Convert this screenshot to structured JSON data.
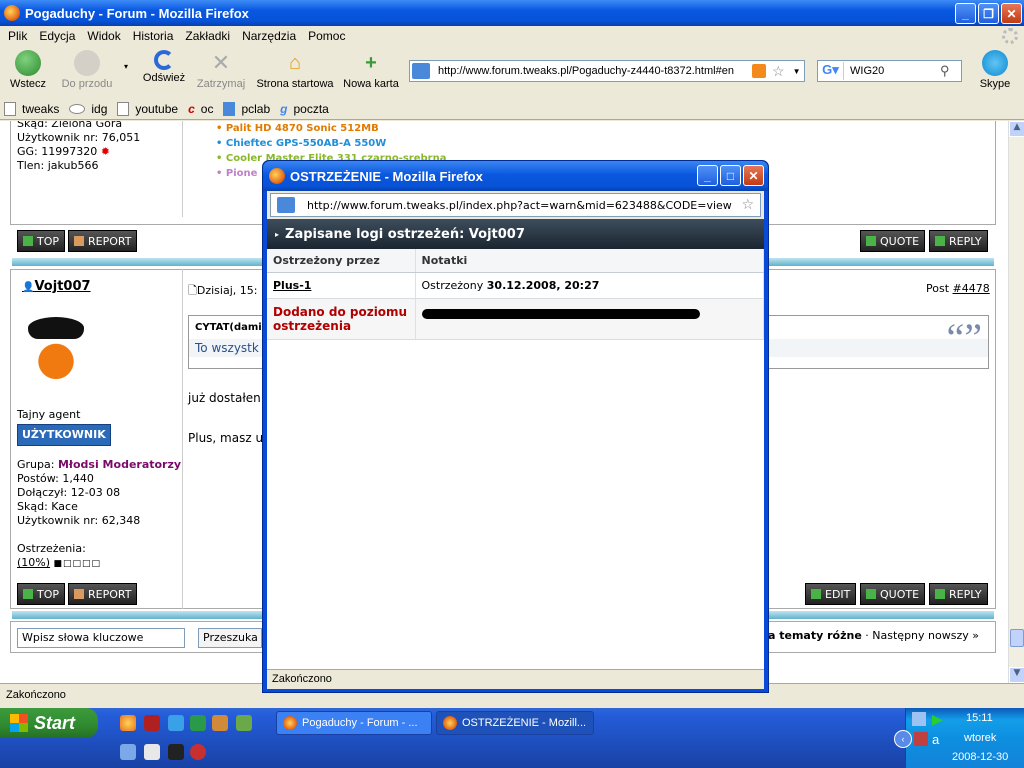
{
  "window": {
    "title": "Pogaduchy - Forum - Mozilla Firefox"
  },
  "menu": [
    "Plik",
    "Edycja",
    "Widok",
    "Historia",
    "Zakładki",
    "Narzędzia",
    "Pomoc"
  ],
  "nav": {
    "back": "Wstecz",
    "forward": "Do przodu",
    "reload": "Odśwież",
    "stop": "Zatrzymaj",
    "home": "Strona startowa",
    "newtab": "Nowa karta",
    "skype": "Skype"
  },
  "url": "http://www.forum.tweaks.pl/Pogaduchy-z4440-t8372.html#en",
  "search": "WIG20",
  "bookmarks": [
    "tweaks",
    "idg",
    "youtube",
    "oc",
    "pclab",
    "poczta"
  ],
  "forum": {
    "user1": {
      "skad": "Skąd: Zielona Góra",
      "nr": "Użytkownik nr: 76,051",
      "gg": "GG: 11997320",
      "tlen": "Tlen: jakub566"
    },
    "specs": [
      "Palit HD 4870 Sonic 512MB",
      "Chieftec GPS-550AB-A 550W",
      "Cooler Master Elite 331 czarno-srebrna",
      "Pione"
    ],
    "top": "TOP",
    "report": "REPORT",
    "quote": "QUOTE",
    "reply": "REPLY",
    "edit": "EDIT",
    "post": {
      "author": "Vojt007",
      "date": "Dzisiaj, 15:",
      "post_label": "Post",
      "post_num": "#4478",
      "quote_head": "CYTAT(dami",
      "quote_text": "To wszystk",
      "line1": "już dostałen",
      "line2": "Plus, masz u"
    },
    "user2": {
      "title": "Tajny agent",
      "badge": "UŻYTKOWNIK",
      "grupa_label": "Grupa:",
      "grupa": "Młodsi Moderatorzy",
      "posty": "Postów: 1,440",
      "dolaczyl": "Dołączył: 12-03 08",
      "skad": "Skąd: Kace",
      "nr": "Użytkownik nr: 62,348",
      "ostrz": "Ostrzeżenia:",
      "ostrz_val": "(10%)"
    },
    "search_placeholder": "Wpisz słowa kluczowe",
    "search_btn": "Przeszuka",
    "bottom_nav_bold": "a tematy różne",
    "bottom_nav": " · Następny nowszy »"
  },
  "status": "Zakończono",
  "popup": {
    "title": "OSTRZEŻENIE - Mozilla Firefox",
    "url": "http://www.forum.tweaks.pl/index.php?act=warn&mid=623488&CODE=view",
    "heading": "Zapisane logi ostrzeżeń: Vojt007",
    "col1": "Ostrzeżony przez",
    "col2": "Notatki",
    "row1_user": "Plus-1",
    "row1_label": "Ostrzeżony",
    "row1_date": "30.12.2008, 20:27",
    "row2_label": "Dodano do poziomu ostrzeżenia",
    "status": "Zakończono"
  },
  "taskbar": {
    "start": "Start",
    "task1": "Pogaduchy - Forum - ...",
    "task2": "OSTRZEŻENIE - Mozill...",
    "time": "15:11",
    "day": "wtorek",
    "date": "2008-12-30"
  }
}
